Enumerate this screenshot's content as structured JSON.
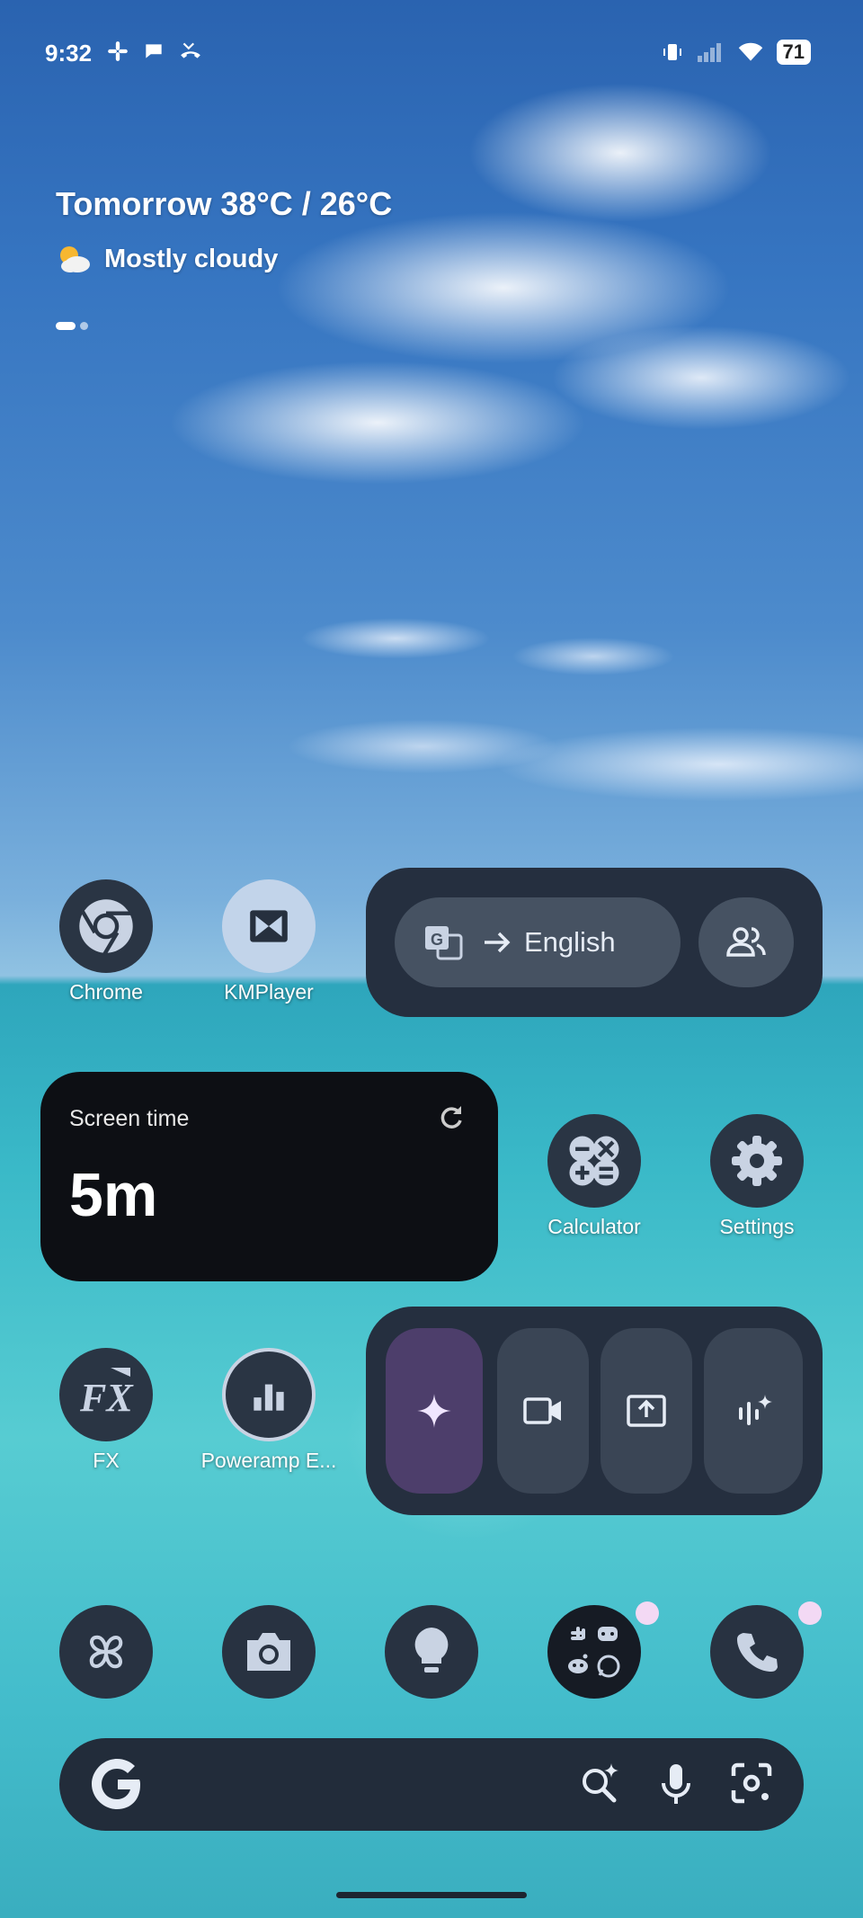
{
  "status_bar": {
    "time": "9:32",
    "notification_icons": [
      "slack-icon",
      "chat-bubble-icon",
      "missed-call-icon"
    ],
    "battery": "71"
  },
  "weather": {
    "forecast": "Tomorrow 38°C / 26°C",
    "condition": "Mostly cloudy"
  },
  "apps": {
    "chrome": "Chrome",
    "kmplayer": "KMPlayer",
    "calculator": "Calculator",
    "settings": "Settings",
    "fx": "FX",
    "poweramp": "Poweramp E..."
  },
  "translate_widget": {
    "target_language": "English"
  },
  "screen_time": {
    "title": "Screen time",
    "value": "5m"
  },
  "dock": {
    "icons": [
      "pinwheel-icon",
      "camera-icon",
      "lightbulb-icon",
      "app-folder-icon",
      "phone-icon"
    ]
  },
  "search_bar": {
    "icons": [
      "google-g-icon",
      "search-sparkle-icon",
      "mic-icon",
      "lens-icon"
    ]
  },
  "colors": {
    "widget_bg": "#252f3f",
    "gemini_accent": "#4d3e6b",
    "badge": "#f3d9f4"
  }
}
